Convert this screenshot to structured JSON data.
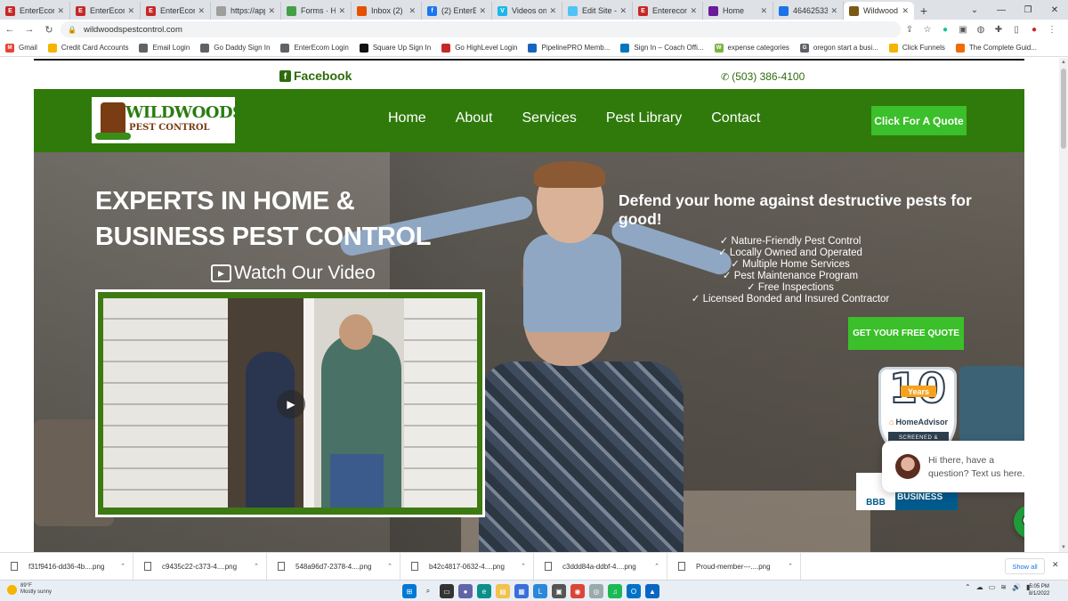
{
  "browser": {
    "tabs": [
      {
        "label": "EnterEcom",
        "fav": "#c62828",
        "glyph": "E"
      },
      {
        "label": "EnterEcom",
        "fav": "#c62828",
        "glyph": "E"
      },
      {
        "label": "EnterEcom",
        "fav": "#c62828",
        "glyph": "E"
      },
      {
        "label": "https://app",
        "fav": "#9e9e9e",
        "glyph": ""
      },
      {
        "label": "Forms · Hig",
        "fav": "#43a047",
        "glyph": ""
      },
      {
        "label": "Inbox (2)",
        "fav": "#e65100",
        "glyph": ""
      },
      {
        "label": "(2) EnterEc",
        "fav": "#1877f2",
        "glyph": "f"
      },
      {
        "label": "Videos on",
        "fav": "#1ab7ea",
        "glyph": "V"
      },
      {
        "label": "Edit Site -",
        "fav": "#4fc3f7",
        "glyph": ""
      },
      {
        "label": "Enterecom",
        "fav": "#c62828",
        "glyph": "E"
      },
      {
        "label": "Home",
        "fav": "#6a1b9a",
        "glyph": ""
      },
      {
        "label": "46462533",
        "fav": "#1a73e8",
        "glyph": ""
      },
      {
        "label": "Wildwood",
        "fav": "#7a5a16",
        "glyph": ""
      }
    ],
    "active_tab": 12,
    "url": "wildwoodspestcontrol.com",
    "bookmarks": [
      {
        "label": "Gmail",
        "color": "#ea4335",
        "glyph": "M"
      },
      {
        "label": "Credit Card Accounts",
        "color": "#f4b400",
        "glyph": ""
      },
      {
        "label": "Email Login",
        "color": "#5f6368",
        "glyph": ""
      },
      {
        "label": "Go Daddy Sign In",
        "color": "#5f6368",
        "glyph": ""
      },
      {
        "label": "EnterEcom Login",
        "color": "#5f6368",
        "glyph": ""
      },
      {
        "label": "Square Up Sign In",
        "color": "#111111",
        "glyph": ""
      },
      {
        "label": "Go HighLevel Login",
        "color": "#c62828",
        "glyph": ""
      },
      {
        "label": "PipelinePRO Memb...",
        "color": "#1565c0",
        "glyph": ""
      },
      {
        "label": "Sign In – Coach Offi...",
        "color": "#0277bd",
        "glyph": ""
      },
      {
        "label": "expense categories",
        "color": "#7cb342",
        "glyph": "W"
      },
      {
        "label": "oregon start a busi...",
        "color": "#5f6368",
        "glyph": "G"
      },
      {
        "label": "Click Funnels",
        "color": "#f4b400",
        "glyph": ""
      },
      {
        "label": "The Complete Guid...",
        "color": "#ef6c00",
        "glyph": ""
      }
    ]
  },
  "site": {
    "facebook_label": "Facebook",
    "phone": "(503) 386-4100",
    "logo_line1": "WILDWOODS",
    "logo_line2": "PEST CONTROL",
    "nav": [
      "Home",
      "About",
      "Services",
      "Pest Library",
      "Contact"
    ],
    "quote_button": "Click For A Quote",
    "hero_title": "EXPERTS IN HOME & BUSINESS PEST CONTROL",
    "watch_video": "Watch Our Video",
    "tagline": "Defend your home against destructive pests for good!",
    "features": [
      "✓ Nature-Friendly Pest Control",
      "✓ Locally Owned and Operated",
      "✓ Multiple Home Services",
      "✓ Pest Maintenance Program",
      "✓ Free Inspections",
      "✓ Licensed Bonded and Insured Contractor"
    ],
    "free_quote_button": "GET YOUR FREE QUOTE",
    "badge_number": "10",
    "badge_years": "Years",
    "badge_brand": "HomeAdvisor",
    "badge_screened": "SCREENED &",
    "bbb_logo": "BBB",
    "bbb_label": "BUSINESS",
    "chat_message": "Hi there, have a question? Text us here."
  },
  "downloads": {
    "items": [
      "f31f9416-dd36-4b....png",
      "c9435c22-c373-4....png",
      "548a96d7-2378-4....png",
      "b42c4817-0632-4....png",
      "c3ddd84a-ddbf-4....png",
      "Proud-member---....png"
    ],
    "show_all": "Show all"
  },
  "taskbar": {
    "temp": "89°F",
    "condition": "Mostly sunny",
    "time": "5:05 PM",
    "date": "8/1/2022"
  }
}
